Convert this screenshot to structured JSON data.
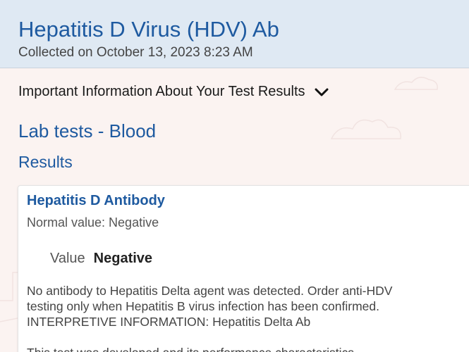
{
  "header": {
    "title": "Hepatitis D Virus (HDV) Ab",
    "collected": "Collected on October 13, 2023 8:23 AM"
  },
  "info_toggle": {
    "label": "Important Information About Your Test Results",
    "icon": "chevron-down-icon"
  },
  "lab_heading": "Lab tests - Blood",
  "results_heading": "Results",
  "result": {
    "name": "Hepatitis D Antibody",
    "normal_value": "Normal value: Negative",
    "value_label": "Value",
    "value": "Negative",
    "comment_line1": "No antibody to Hepatitis Delta agent was detected. Order anti-HDV",
    "comment_line2": "testing only when Hepatitis B virus infection has been confirmed.",
    "comment_line3": "INTERPRETIVE INFORMATION: Hepatitis Delta Ab",
    "comment_line4": "This test was developed and its performance characteristics"
  },
  "colors": {
    "accent": "#1e5aa0",
    "header_bg": "#dfe9f3",
    "page_bg": "#fbf3f1"
  }
}
